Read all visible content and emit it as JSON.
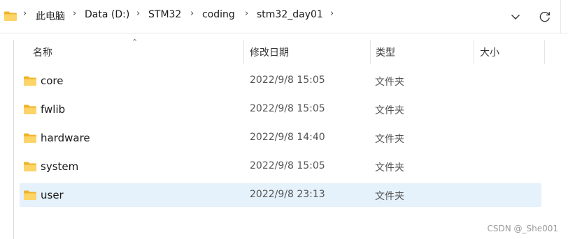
{
  "address_bar": {
    "folder_icon": "folder-icon",
    "crumbs": [
      "此电脑",
      "Data (D:)",
      "STM32",
      "coding",
      "stm32_day01"
    ],
    "separator": "›",
    "dropdown_icon": "chevron-down-icon",
    "refresh_icon": "refresh-icon"
  },
  "columns": {
    "name": "名称",
    "date": "修改日期",
    "type": "类型",
    "size": "大小"
  },
  "rows": [
    {
      "name": "core",
      "date": "2022/9/8 15:05",
      "type": "文件夹",
      "size": ""
    },
    {
      "name": "fwlib",
      "date": "2022/9/8 15:05",
      "type": "文件夹",
      "size": ""
    },
    {
      "name": "hardware",
      "date": "2022/9/8 14:40",
      "type": "文件夹",
      "size": ""
    },
    {
      "name": "system",
      "date": "2022/9/8 15:05",
      "type": "文件夹",
      "size": ""
    },
    {
      "name": "user",
      "date": "2022/9/8 23:13",
      "type": "文件夹",
      "size": "",
      "selected": true
    }
  ],
  "colors": {
    "folder": "#f6c443",
    "selected_row": "#e5f1fb"
  },
  "watermark": "CSDN @_She001"
}
